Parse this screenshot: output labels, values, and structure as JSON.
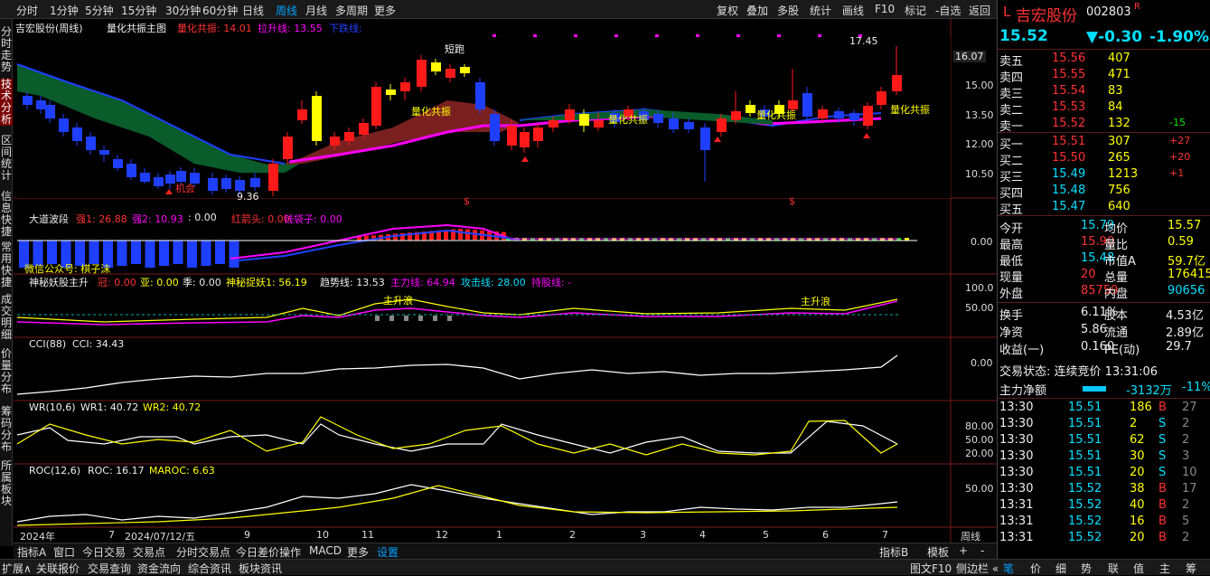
{
  "toolbar": {
    "periods": [
      "分时",
      "1分钟",
      "5分钟",
      "15分钟",
      "30分钟",
      "60分钟",
      "日线",
      "周线",
      "月线",
      "多周期",
      "更多"
    ],
    "active_period": "周线",
    "right": [
      "复权",
      "叠加",
      "多股",
      "统计",
      "画线",
      "F10",
      "标记",
      "-自选",
      "返回"
    ]
  },
  "left_tabs": [
    "分时走势",
    "技术分析",
    "区间统计",
    "信息快捷",
    "常用快捷",
    "成交明细",
    "价量分布",
    "筹码分布",
    "所属板块"
  ],
  "main": {
    "stock": "吉宏股份(周线)",
    "indicator": "量化共振主图",
    "p1": "量化共振: 14.01",
    "p2": "拉升线: 13.55",
    "p3": "下跌线: ",
    "labels": {
      "chance": "机会",
      "low": "9.36",
      "run": "短跑",
      "res1": "量化共振",
      "res2": "量化共振",
      "res3": "量化共振",
      "res4": "量化共振",
      "high": "17.45",
      "cur_price": "16.07"
    },
    "yaxis": [
      "15.00",
      "13.50",
      "12.00",
      "10.50"
    ]
  },
  "p2": {
    "name": "大道波段",
    "v1": "强1: 26.88",
    "v2": "强2: 10.93",
    "v3": ": 0.00",
    "v4": "红箭头: 0.00",
    "v5": "钱袋子: 0.00",
    "note": "微信公众号: 棋子沫",
    "axis": "0.00"
  },
  "p3": {
    "name": "神秘妖股主升",
    "v1": "冠: 0.00",
    "v2": "亚: 0.00",
    "v3": "季: 0.00",
    "v4": "神秘捉妖1: 56.19",
    "v5": "趋势线: 13.53",
    "v6": "主力线: 64.94",
    "v7": "攻击线: 28.00",
    "v8": "持股线: -",
    "lab": "主升浪",
    "axis": [
      "100.0",
      "50.00"
    ]
  },
  "p4": {
    "name": "CCI(88)",
    "v1": "CCI: 34.43",
    "axis": "0.00"
  },
  "p5": {
    "name": "WR(10,6)",
    "v1": "WR1: 40.72",
    "v2": "WR2: 40.72",
    "axis": [
      "80.00",
      "50.00",
      "20.00"
    ]
  },
  "p6": {
    "name": "ROC(12,6)",
    "v1": "ROC: 16.17",
    "v2": "MAROC: 6.63",
    "axis": "50.00"
  },
  "xaxis": {
    "labels": [
      "2024年",
      "7",
      "2024/07/12/五",
      "9",
      "10",
      "11",
      "12",
      "1",
      "2",
      "3",
      "4",
      "5",
      "6",
      "7"
    ],
    "period": "周线"
  },
  "bottom1": {
    "left": [
      "指标A",
      "窗口",
      "今日交易",
      "交易点",
      "分时交易点",
      "今日差价操作",
      "MACD",
      "更多",
      "设置"
    ],
    "right": [
      "指标B",
      "模板",
      "+",
      "-"
    ]
  },
  "bottom2": {
    "left": [
      "扩展∧",
      "关联报价",
      "交易查询",
      "资金流向",
      "综合资讯",
      "板块资讯"
    ],
    "right": [
      "图文F10",
      "侧边栏 «",
      "笔",
      "价",
      "细",
      "势",
      "联",
      "值",
      "主",
      "筹"
    ]
  },
  "quote": {
    "market": "L",
    "name": "吉宏股份",
    "code": "002803",
    "flag": "R",
    "price": "15.52",
    "change": "▼-0.30",
    "pct": "-1.90%",
    "sells": [
      [
        "卖五",
        "15.56",
        "407",
        ""
      ],
      [
        "卖四",
        "15.55",
        "471",
        ""
      ],
      [
        "卖三",
        "15.54",
        "83",
        ""
      ],
      [
        "卖二",
        "15.53",
        "84",
        ""
      ],
      [
        "卖一",
        "15.52",
        "132",
        "-15"
      ]
    ],
    "buys": [
      [
        "买一",
        "15.51",
        "307",
        "+27"
      ],
      [
        "买二",
        "15.50",
        "265",
        "+20"
      ],
      [
        "买三",
        "15.49",
        "1213",
        "+1"
      ],
      [
        "买四",
        "15.48",
        "756",
        ""
      ],
      [
        "买五",
        "15.47",
        "640",
        ""
      ]
    ],
    "stats": [
      [
        "今开",
        "15.79",
        "均价",
        "15.57"
      ],
      [
        "最高",
        "15.90",
        "量比",
        "0.59"
      ],
      [
        "最低",
        "15.48",
        "市值A",
        "59.7亿"
      ],
      [
        "现量",
        "20",
        "总量",
        "176415"
      ],
      [
        "外盘",
        "85759",
        "内盘",
        "90656"
      ]
    ],
    "stats2": [
      [
        "换手",
        "6.11%",
        "股本",
        "4.53亿"
      ],
      [
        "净资",
        "5.86",
        "流通",
        "2.89亿"
      ],
      [
        "收益(一)",
        "0.160",
        "PE(动)",
        "29.7"
      ]
    ],
    "status": "交易状态: 连续竞价 13:31:06",
    "flow_label": "主力净额",
    "flow_val": "-3132万",
    "flow_pct": "-11%",
    "ticks": [
      [
        "13:30",
        "15.51",
        "186",
        "B",
        "27"
      ],
      [
        "13:30",
        "15.51",
        "2",
        "S",
        "2"
      ],
      [
        "13:30",
        "15.51",
        "62",
        "S",
        "2"
      ],
      [
        "13:30",
        "15.51",
        "30",
        "S",
        "3"
      ],
      [
        "13:30",
        "15.51",
        "20",
        "S",
        "10"
      ],
      [
        "13:30",
        "15.52",
        "38",
        "B",
        "17"
      ],
      [
        "13:31",
        "15.52",
        "40",
        "B",
        "2"
      ],
      [
        "13:31",
        "15.52",
        "16",
        "B",
        "5"
      ],
      [
        "13:31",
        "15.52",
        "20",
        "B",
        "2"
      ]
    ]
  },
  "chart_data": {
    "type": "candlestick",
    "title": "吉宏股份(周线)",
    "indicators": [
      "量化共振主图",
      "大道波段",
      "神秘妖股主升",
      "CCI(88)",
      "WR(10,6)",
      "ROC(12,6)"
    ],
    "annotated_high": 17.45,
    "annotated_low": 9.36
  }
}
